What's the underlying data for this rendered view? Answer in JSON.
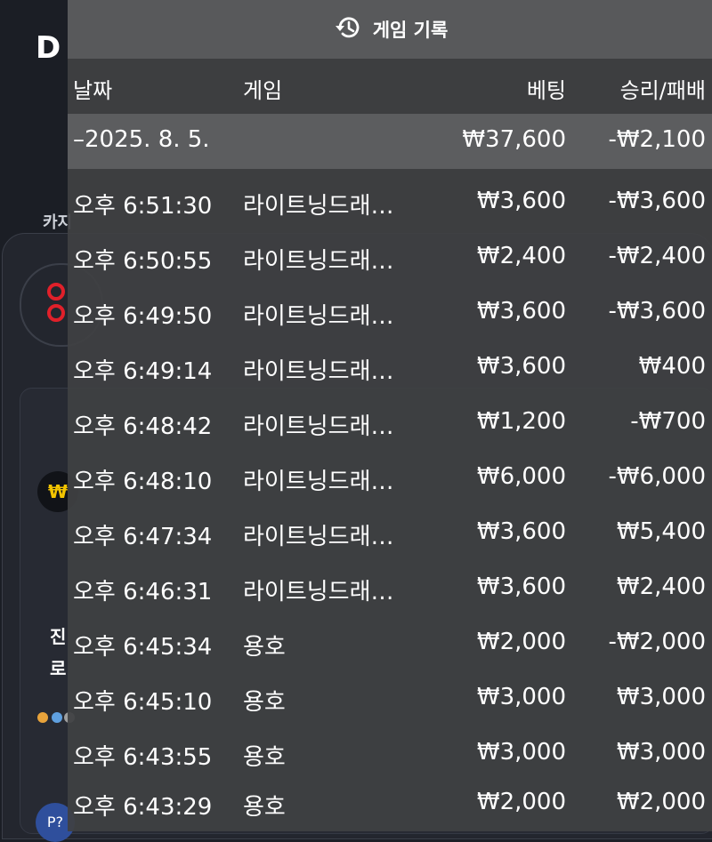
{
  "background": {
    "logo": "D",
    "category": "카지",
    "card_symbol": "₩",
    "card_text_1": "진",
    "card_text_2": "로",
    "avatar": "P?"
  },
  "modal": {
    "title": "게임 기록",
    "icon": "history-icon",
    "headers": {
      "date": "날짜",
      "game": "게임",
      "bet": "베팅",
      "result": "승리/패배"
    },
    "summary": {
      "date": "–2025. 8. 5.",
      "game": "",
      "bet": "₩37,600",
      "result": "-₩2,100"
    },
    "rows": [
      {
        "time": "오후 6:51:30",
        "game": "라이트닝드래…",
        "bet": "₩3,600",
        "result": "-₩3,600"
      },
      {
        "time": "오후 6:50:55",
        "game": "라이트닝드래…",
        "bet": "₩2,400",
        "result": "-₩2,400"
      },
      {
        "time": "오후 6:49:50",
        "game": "라이트닝드래…",
        "bet": "₩3,600",
        "result": "-₩3,600"
      },
      {
        "time": "오후 6:49:14",
        "game": "라이트닝드래…",
        "bet": "₩3,600",
        "result": "₩400"
      },
      {
        "time": "오후 6:48:42",
        "game": "라이트닝드래…",
        "bet": "₩1,200",
        "result": "-₩700"
      },
      {
        "time": "오후 6:48:10",
        "game": "라이트닝드래…",
        "bet": "₩6,000",
        "result": "-₩6,000"
      },
      {
        "time": "오후 6:47:34",
        "game": "라이트닝드래…",
        "bet": "₩3,600",
        "result": "₩5,400"
      },
      {
        "time": "오후 6:46:31",
        "game": "라이트닝드래…",
        "bet": "₩3,600",
        "result": "₩2,400"
      },
      {
        "time": "오후 6:45:34",
        "game": "용호",
        "bet": "₩2,000",
        "result": "-₩2,000"
      },
      {
        "time": "오후 6:45:10",
        "game": "용호",
        "bet": "₩3,000",
        "result": "₩3,000"
      },
      {
        "time": "오후 6:43:55",
        "game": "용호",
        "bet": "₩3,000",
        "result": "₩3,000"
      },
      {
        "time": "오후 6:43:29",
        "game": "용호",
        "bet": "₩2,000",
        "result": "₩2,000"
      }
    ]
  }
}
